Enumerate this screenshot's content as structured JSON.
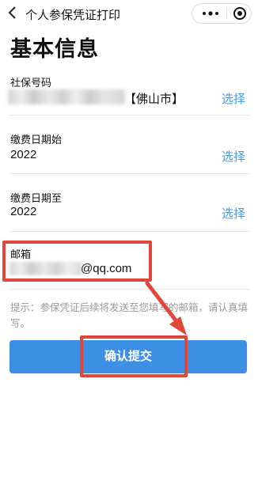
{
  "topbar": {
    "title": "个人参保凭证打印",
    "back_icon": "chevron-left-icon",
    "more_icon": "more-dots-icon",
    "close_icon": "target-icon"
  },
  "page_title": "基本信息",
  "fields": [
    {
      "label": "社保号码",
      "value": "【佛山市】",
      "action": "选择"
    },
    {
      "label": "缴费日期始",
      "value": "2022",
      "action": "选择"
    },
    {
      "label": "缴费日期至",
      "value": "2022",
      "action": "选择"
    },
    {
      "label": "邮箱",
      "value": "@qq.com"
    }
  ],
  "hint": "提示：参保凭证后续将发送至您填写的邮箱，请认真填写。",
  "submit_label": "确认提交",
  "colors": {
    "accent": "#3d8fe6",
    "link": "#3d9be9",
    "annotation": "#e0463a"
  }
}
